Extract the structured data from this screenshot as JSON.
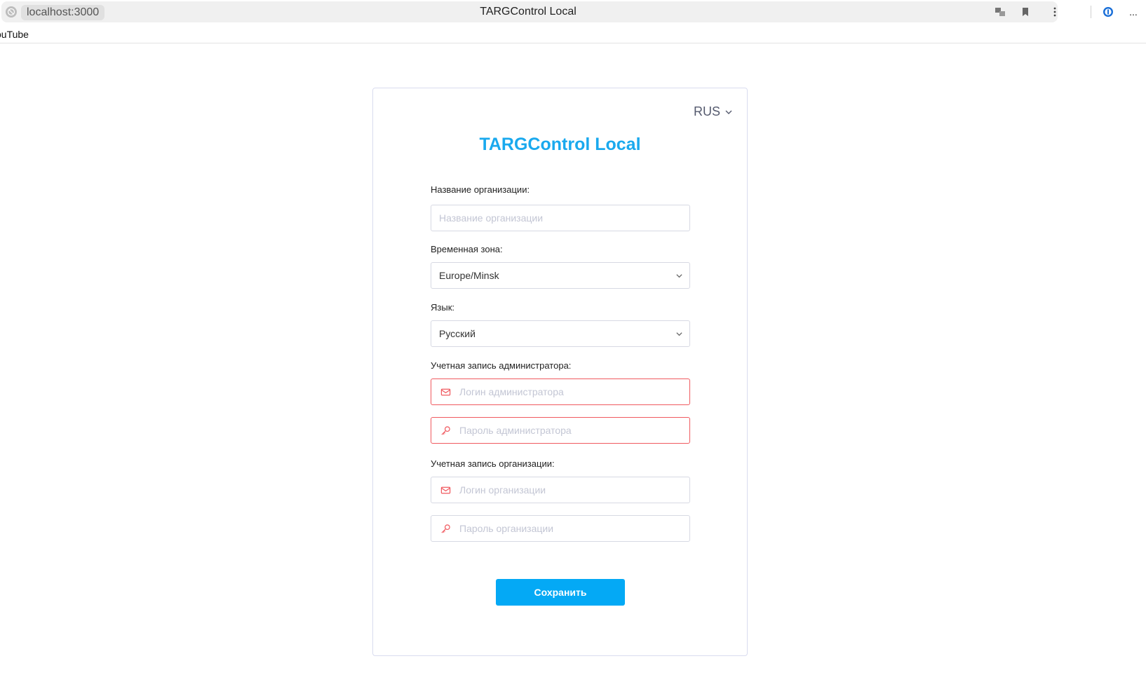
{
  "browser": {
    "url": "localhost:3000",
    "tab_title": "TARGControl Local",
    "bookmark": "ouTube",
    "icons": [
      "site-info-icon",
      "translate-icon",
      "bookmark-icon",
      "kebab-menu-icon",
      "password-manager-icon",
      "more-icon"
    ],
    "more_label": "..."
  },
  "card": {
    "language_switch": "RUS",
    "title": "TARGControl Local",
    "org_name_label": "Название организации:",
    "org_name_placeholder": "Название организации",
    "timezone_label": "Временная зона:",
    "timezone_value": "Europe/Minsk",
    "language_label": "Язык:",
    "language_value": "Русский",
    "admin_account_label": "Учетная запись администратора:",
    "admin_login_placeholder": "Логин администратора",
    "admin_password_placeholder": "Пароль администратора",
    "org_account_label": "Учетная запись организации:",
    "org_login_placeholder": "Логин организации",
    "org_password_placeholder": "Пароль организации",
    "save_label": "Сохранить"
  },
  "colors": {
    "accent": "#04a9f5",
    "title": "#1aa9ee",
    "error": "#f0595f",
    "icon_red": "#f0595f"
  }
}
